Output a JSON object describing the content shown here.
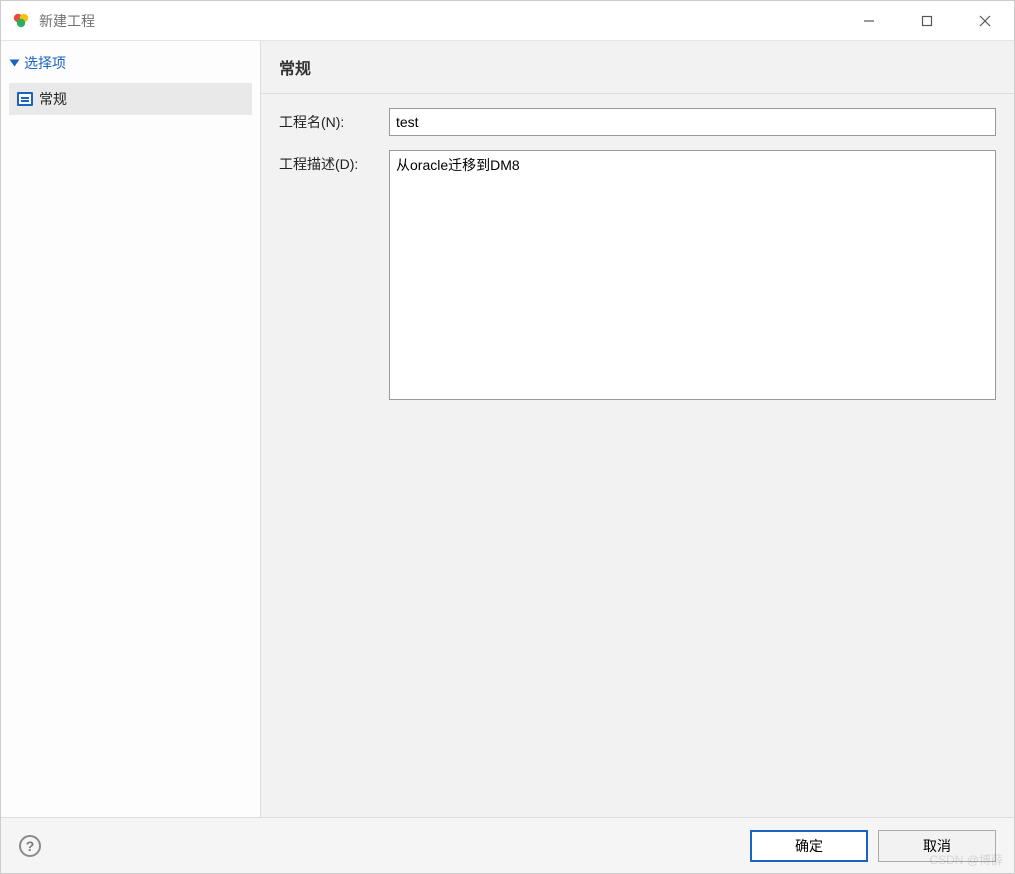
{
  "window": {
    "title": "新建工程"
  },
  "sidebar": {
    "group_label": "选择项",
    "items": [
      {
        "label": "常规"
      }
    ]
  },
  "panel": {
    "heading": "常规",
    "project_name_label": "工程名(N):",
    "project_name_value": "test",
    "project_desc_label": "工程描述(D):",
    "project_desc_value": "从oracle迁移到DM8"
  },
  "footer": {
    "help_glyph": "?",
    "ok_label": "确定",
    "cancel_label": "取消"
  },
  "watermark": "CSDN @博薛"
}
